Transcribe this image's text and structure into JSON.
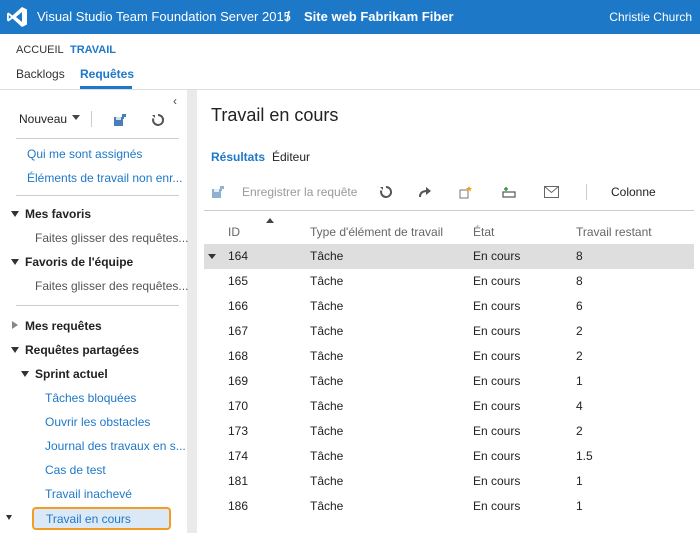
{
  "topbar": {
    "product": "Visual Studio Team Foundation Server 2015",
    "separator": "/",
    "project": "Site web Fabrikam Fiber",
    "user": "Christie Church"
  },
  "hubs": {
    "home": "ACCUEIL",
    "work": "TRAVAIL"
  },
  "subtabs": {
    "backlogs": "Backlogs",
    "queries": "Requêtes"
  },
  "left": {
    "new_label": "Nouveau",
    "links": [
      "Qui me sont assignés",
      "Éléments de travail non enr..."
    ],
    "my_favorites": "Mes favoris",
    "my_favorites_hint": "Faites glisser des requêtes...",
    "team_favorites": "Favoris de l'équipe",
    "team_favorites_hint": "Faites glisser des requêtes...",
    "my_queries": "Mes requêtes",
    "shared_queries": "Requêtes partagées",
    "current_sprint": "Sprint actuel",
    "sprint_items": [
      "Tâches bloquées",
      "Ouvrir les obstacles",
      "Journal des travaux en s...",
      "Cas de test",
      "Travail inachevé"
    ],
    "selected_item": "Travail en cours"
  },
  "main": {
    "title": "Travail en cours",
    "tab_results": "Résultats",
    "tab_editor": "Éditeur",
    "toolbar": {
      "save": "Enregistrer la requête",
      "column": "Colonne"
    },
    "columns": [
      "ID",
      "Type d'élément de travail",
      "État",
      "Travail restant"
    ],
    "rows": [
      {
        "id": "164",
        "type": "Tâche",
        "state": "En cours",
        "remaining": "8"
      },
      {
        "id": "165",
        "type": "Tâche",
        "state": "En cours",
        "remaining": "8"
      },
      {
        "id": "166",
        "type": "Tâche",
        "state": "En cours",
        "remaining": "6"
      },
      {
        "id": "167",
        "type": "Tâche",
        "state": "En cours",
        "remaining": "2"
      },
      {
        "id": "168",
        "type": "Tâche",
        "state": "En cours",
        "remaining": "2"
      },
      {
        "id": "169",
        "type": "Tâche",
        "state": "En cours",
        "remaining": "1"
      },
      {
        "id": "170",
        "type": "Tâche",
        "state": "En cours",
        "remaining": "4"
      },
      {
        "id": "173",
        "type": "Tâche",
        "state": "En cours",
        "remaining": "2"
      },
      {
        "id": "174",
        "type": "Tâche",
        "state": "En cours",
        "remaining": "1.5"
      },
      {
        "id": "181",
        "type": "Tâche",
        "state": "En cours",
        "remaining": "1"
      },
      {
        "id": "186",
        "type": "Tâche",
        "state": "En cours",
        "remaining": "1"
      }
    ]
  },
  "colors": {
    "accent": "#1e78c8",
    "highlight_border": "#f29b25",
    "selected_row": "#dedede"
  },
  "icons": [
    "visual-studio-logo-icon",
    "collapse-chevron-icon",
    "save-query-icon",
    "refresh-icon",
    "redo-icon",
    "new-work-item-icon",
    "link-icon",
    "email-icon"
  ]
}
